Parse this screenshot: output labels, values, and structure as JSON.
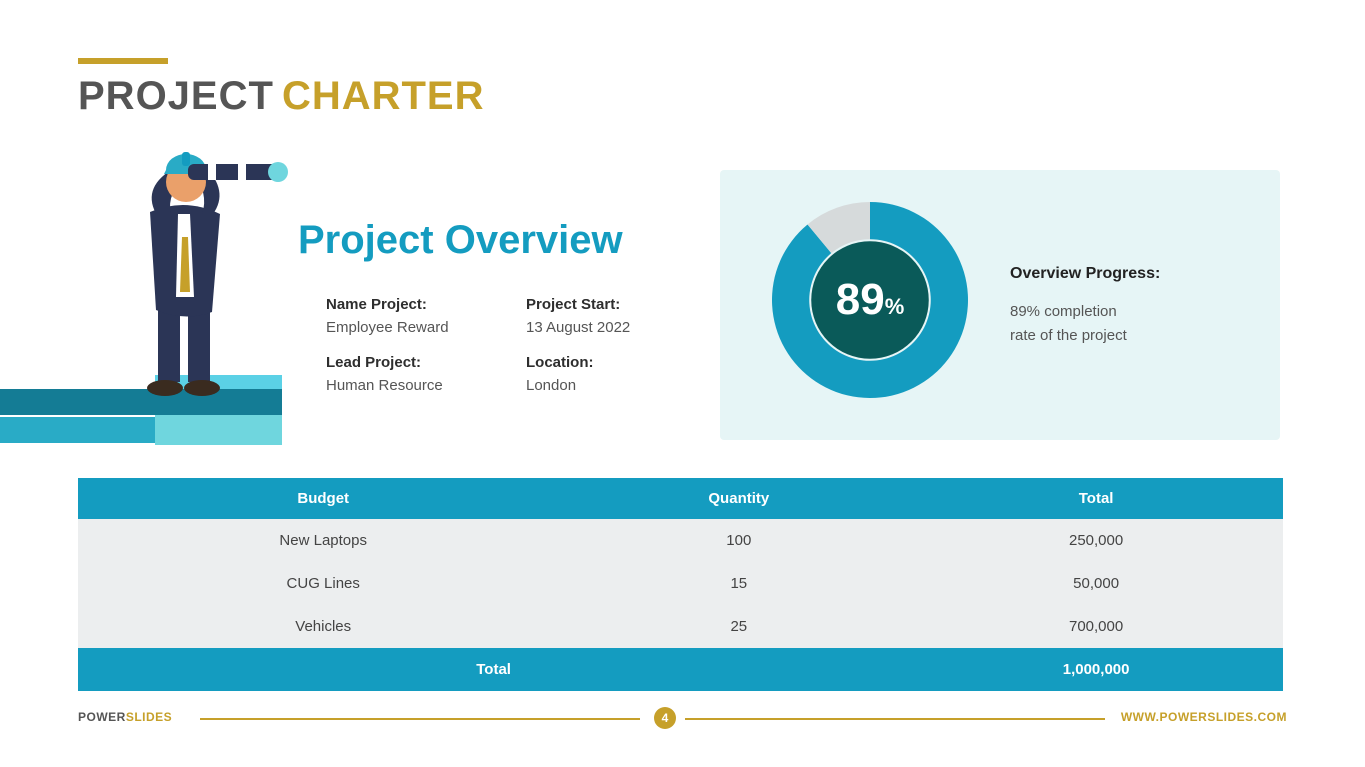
{
  "title": {
    "word1": "PROJECT",
    "word2": "CHARTER"
  },
  "overview": {
    "heading": "Project Overview",
    "fields": {
      "name_label": "Name Project:",
      "name_value": "Employee Reward",
      "start_label": "Project Start:",
      "start_value": "13 August 2022",
      "lead_label": "Lead Project:",
      "lead_value": "Human Resource",
      "loc_label": "Location:",
      "loc_value": "London"
    }
  },
  "progress": {
    "value": 89,
    "display": "89",
    "symbol": "%",
    "label": "Overview Progress:",
    "sub1": "89% completion",
    "sub2": "rate of the project"
  },
  "chart_data": {
    "type": "pie",
    "title": "Overview Progress",
    "series": [
      {
        "name": "Completed",
        "value": 89,
        "color": "#149cc0"
      },
      {
        "name": "Remaining",
        "value": 11,
        "color": "#d6dadb"
      }
    ],
    "center_fill": "#0a5a59",
    "inner_ratio": 0.62
  },
  "table": {
    "headers": [
      "Budget",
      "Quantity",
      "Total"
    ],
    "rows": [
      {
        "budget": "New Laptops",
        "qty": "100",
        "total": "250,000"
      },
      {
        "budget": "CUG Lines",
        "qty": "15",
        "total": "50,000"
      },
      {
        "budget": "Vehicles",
        "qty": "25",
        "total": "700,000"
      }
    ],
    "footer": {
      "label": "Total",
      "value": "1,000,000"
    }
  },
  "footer": {
    "brand1": "POWER",
    "brand2": "SLIDES",
    "url": "WWW.POWERSLIDES.COM",
    "page": "4"
  },
  "colors": {
    "accent": "#c6a02a",
    "teal": "#149cc0",
    "teal_dark": "#0a5a59",
    "gray": "#d6dadb",
    "panel": "#e6f5f6"
  }
}
